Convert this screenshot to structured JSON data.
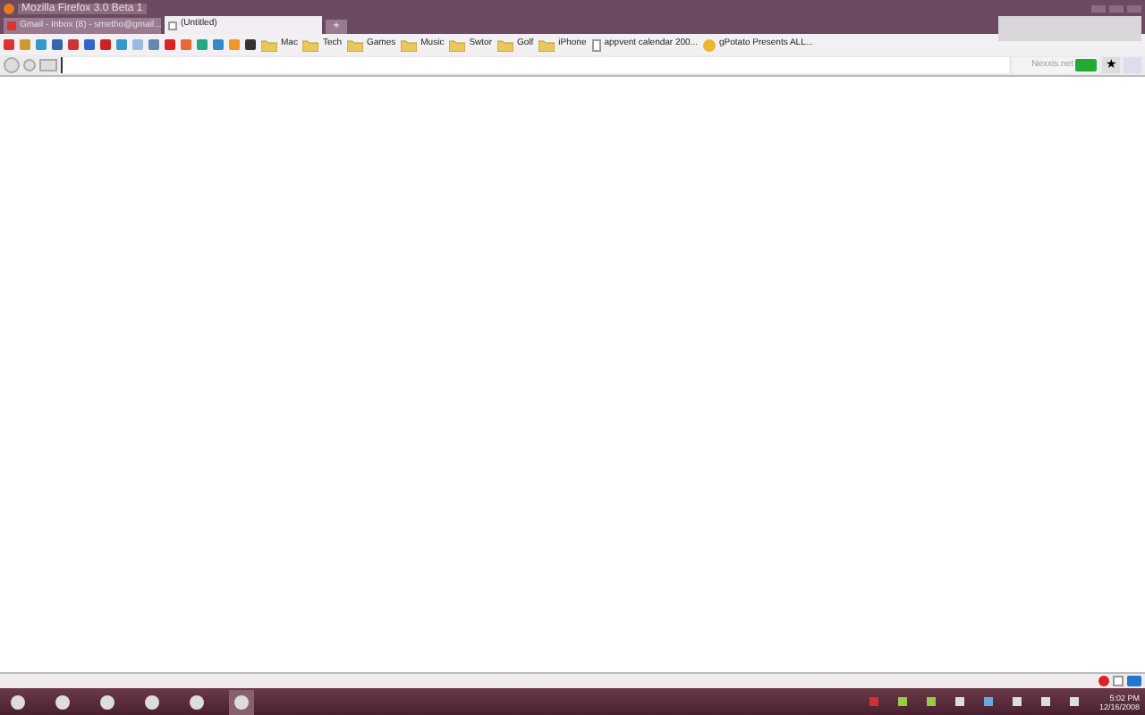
{
  "window": {
    "title": "Mozilla Firefox 3.0 Beta 1"
  },
  "tabs": [
    {
      "label": "Gmail - Inbox (8) - smetho@gmail...",
      "selected": false
    },
    {
      "label": "(Untitled)",
      "selected": true
    }
  ],
  "new_tab": {
    "label": "+"
  },
  "bookmarks": [
    {
      "label": "Mac",
      "kind": "folder"
    },
    {
      "label": "Tech",
      "kind": "folder"
    },
    {
      "label": "Games",
      "kind": "folder"
    },
    {
      "label": "Music",
      "kind": "folder"
    },
    {
      "label": "Swtor",
      "kind": "folder"
    },
    {
      "label": "Golf",
      "kind": "folder"
    },
    {
      "label": "iPhone",
      "kind": "folder"
    },
    {
      "label": "appvent calendar 200...",
      "kind": "page"
    },
    {
      "label": "gPotato Presents ALL...",
      "kind": "site"
    }
  ],
  "bookmark_star": {
    "label": "★"
  },
  "search": {
    "placeholder": "Nexxis.net"
  },
  "taskbar": {
    "buttons": [
      {
        "selected": false
      },
      {
        "selected": false
      },
      {
        "selected": false
      },
      {
        "selected": false
      },
      {
        "selected": false
      },
      {
        "selected": true
      }
    ]
  },
  "clock": {
    "time": "5:02 PM",
    "date": "12/16/2008"
  }
}
